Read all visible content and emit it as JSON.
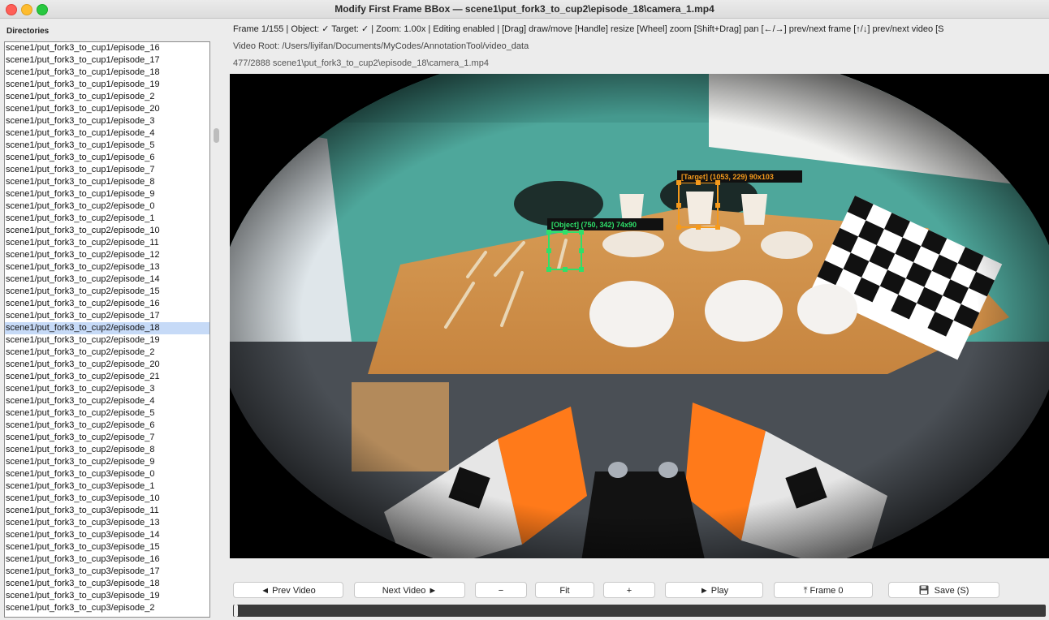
{
  "window": {
    "title": "Modify First Frame BBox — scene1\\put_fork3_to_cup2\\episode_18\\camera_1.mp4"
  },
  "sidebar": {
    "header": "Directories",
    "items": [
      "scene1/put_fork3_to_cup1/episode_16",
      "scene1/put_fork3_to_cup1/episode_17",
      "scene1/put_fork3_to_cup1/episode_18",
      "scene1/put_fork3_to_cup1/episode_19",
      "scene1/put_fork3_to_cup1/episode_2",
      "scene1/put_fork3_to_cup1/episode_20",
      "scene1/put_fork3_to_cup1/episode_3",
      "scene1/put_fork3_to_cup1/episode_4",
      "scene1/put_fork3_to_cup1/episode_5",
      "scene1/put_fork3_to_cup1/episode_6",
      "scene1/put_fork3_to_cup1/episode_7",
      "scene1/put_fork3_to_cup1/episode_8",
      "scene1/put_fork3_to_cup1/episode_9",
      "scene1/put_fork3_to_cup2/episode_0",
      "scene1/put_fork3_to_cup2/episode_1",
      "scene1/put_fork3_to_cup2/episode_10",
      "scene1/put_fork3_to_cup2/episode_11",
      "scene1/put_fork3_to_cup2/episode_12",
      "scene1/put_fork3_to_cup2/episode_13",
      "scene1/put_fork3_to_cup2/episode_14",
      "scene1/put_fork3_to_cup2/episode_15",
      "scene1/put_fork3_to_cup2/episode_16",
      "scene1/put_fork3_to_cup2/episode_17",
      "scene1/put_fork3_to_cup2/episode_18",
      "scene1/put_fork3_to_cup2/episode_19",
      "scene1/put_fork3_to_cup2/episode_2",
      "scene1/put_fork3_to_cup2/episode_20",
      "scene1/put_fork3_to_cup2/episode_21",
      "scene1/put_fork3_to_cup2/episode_3",
      "scene1/put_fork3_to_cup2/episode_4",
      "scene1/put_fork3_to_cup2/episode_5",
      "scene1/put_fork3_to_cup2/episode_6",
      "scene1/put_fork3_to_cup2/episode_7",
      "scene1/put_fork3_to_cup2/episode_8",
      "scene1/put_fork3_to_cup2/episode_9",
      "scene1/put_fork3_to_cup3/episode_0",
      "scene1/put_fork3_to_cup3/episode_1",
      "scene1/put_fork3_to_cup3/episode_10",
      "scene1/put_fork3_to_cup3/episode_11",
      "scene1/put_fork3_to_cup3/episode_13",
      "scene1/put_fork3_to_cup3/episode_14",
      "scene1/put_fork3_to_cup3/episode_15",
      "scene1/put_fork3_to_cup3/episode_16",
      "scene1/put_fork3_to_cup3/episode_17",
      "scene1/put_fork3_to_cup3/episode_18",
      "scene1/put_fork3_to_cup3/episode_19",
      "scene1/put_fork3_to_cup3/episode_2"
    ],
    "selected_index": 23
  },
  "info": {
    "line1": "Frame 1/155  |  Object: ✓  Target: ✓  |  Zoom: 1.00x  |  Editing enabled  |  [Drag] draw/move  [Handle] resize  [Wheel] zoom  [Shift+Drag] pan  [←/→] prev/next frame  [↑/↓] prev/next video  [S",
    "line2": "Video Root: /Users/liyifan/Documents/MyCodes/AnnotationTool/video_data",
    "line3": "477/2888  scene1\\put_fork3_to_cup2\\episode_18\\camera_1.mp4"
  },
  "annotations": {
    "object_label": "[Object] (750, 342)  74x90",
    "target_label": "[Target] (1053, 229)  90x103",
    "object_color": "#2ee06a",
    "target_color": "#f59a1c"
  },
  "controls": {
    "prev_video": "◄ Prev Video",
    "next_video": "Next Video ►",
    "zoom_out": "−",
    "fit": "Fit",
    "zoom_in": "+",
    "play": "► Play",
    "frame0": "⤒ Frame 0",
    "save": "Save (S)",
    "save_icon": "floppy-disk-icon"
  },
  "playback": {
    "progress": 0.0
  }
}
